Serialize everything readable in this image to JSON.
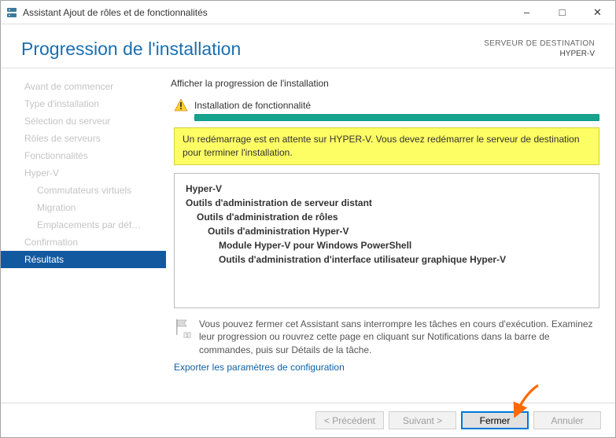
{
  "window": {
    "title": "Assistant Ajout de rôles et de fonctionnalités"
  },
  "header": {
    "page_title": "Progression de l'installation",
    "dest_label": "SERVEUR DE DESTINATION",
    "dest_name": "HYPER-V"
  },
  "sidebar": {
    "items": [
      {
        "label": "Avant de commencer",
        "sub": false,
        "active": false
      },
      {
        "label": "Type d'installation",
        "sub": false,
        "active": false
      },
      {
        "label": "Sélection du serveur",
        "sub": false,
        "active": false
      },
      {
        "label": "Rôles de serveurs",
        "sub": false,
        "active": false
      },
      {
        "label": "Fonctionnalités",
        "sub": false,
        "active": false
      },
      {
        "label": "Hyper-V",
        "sub": false,
        "active": false
      },
      {
        "label": "Commutateurs virtuels",
        "sub": true,
        "active": false
      },
      {
        "label": "Migration",
        "sub": true,
        "active": false
      },
      {
        "label": "Emplacements par déf…",
        "sub": true,
        "active": false
      },
      {
        "label": "Confirmation",
        "sub": false,
        "active": false
      },
      {
        "label": "Résultats",
        "sub": false,
        "active": true
      }
    ]
  },
  "main": {
    "view_label": "Afficher la progression de l'installation",
    "status": "Installation de fonctionnalité",
    "notice": "Un redémarrage est en attente sur HYPER-V. Vous devez redémarrer le serveur de destination pour terminer l'installation.",
    "results": [
      {
        "indent": 0,
        "bold": true,
        "text": "Hyper-V"
      },
      {
        "indent": 0,
        "bold": true,
        "text": "Outils d'administration de serveur distant"
      },
      {
        "indent": 1,
        "bold": true,
        "text": "Outils d'administration de rôles"
      },
      {
        "indent": 2,
        "bold": true,
        "text": "Outils d'administration Hyper-V"
      },
      {
        "indent": 3,
        "bold": true,
        "text": "Module Hyper-V pour Windows PowerShell"
      },
      {
        "indent": 3,
        "bold": true,
        "text": "Outils d'administration d'interface utilisateur graphique Hyper-V"
      }
    ],
    "footer_note": "Vous pouvez fermer cet Assistant sans interrompre les tâches en cours d'exécution. Examinez leur progression ou rouvrez cette page en cliquant sur Notifications dans la barre de commandes, puis sur Détails de la tâche.",
    "export_link": "Exporter les paramètres de configuration"
  },
  "buttons": {
    "previous": "< Précédent",
    "next": "Suivant >",
    "close": "Fermer",
    "cancel": "Annuler"
  }
}
